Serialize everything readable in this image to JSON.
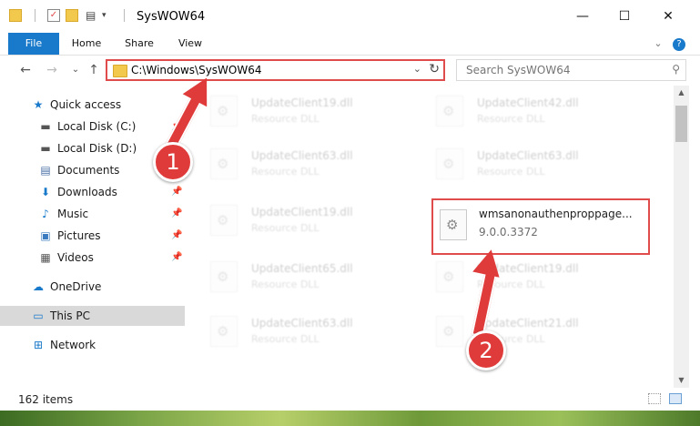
{
  "window": {
    "title": "SysWOW64",
    "controls": {
      "minimize": "—",
      "maximize": "☐",
      "close": "✕"
    }
  },
  "ribbon": {
    "tabs": [
      "File",
      "Home",
      "Share",
      "View"
    ],
    "help": "?",
    "expand": "⌄"
  },
  "navigation": {
    "back": "←",
    "forward": "→",
    "recent": "⌄",
    "up": "↑",
    "address": "C:\\Windows\\SysWOW64",
    "address_dropdown": "⌄",
    "refresh": "↻",
    "search_placeholder": "Search SysWOW64",
    "search_icon": "⚲"
  },
  "sidebar": {
    "items": [
      {
        "label": "Quick access",
        "icon": "star-icon",
        "glyph": "★",
        "color": "#1979ca",
        "pinned": false
      },
      {
        "label": "Local Disk (C:)",
        "icon": "drive-icon",
        "glyph": "▬",
        "color": "#555555",
        "pinned": true
      },
      {
        "label": "Local Disk (D:)",
        "icon": "drive-icon",
        "glyph": "▬",
        "color": "#555555",
        "pinned": true
      },
      {
        "label": "Documents",
        "icon": "document-icon",
        "glyph": "▤",
        "color": "#4a6fa5",
        "pinned": true
      },
      {
        "label": "Downloads",
        "icon": "download-icon",
        "glyph": "⬇",
        "color": "#1979ca",
        "pinned": true
      },
      {
        "label": "Music",
        "icon": "music-icon",
        "glyph": "♪",
        "color": "#1979ca",
        "pinned": true
      },
      {
        "label": "Pictures",
        "icon": "pictures-icon",
        "glyph": "▣",
        "color": "#3a7bbf",
        "pinned": true
      },
      {
        "label": "Videos",
        "icon": "video-icon",
        "glyph": "▦",
        "color": "#555555",
        "pinned": true
      },
      {
        "label": "OneDrive",
        "icon": "cloud-icon",
        "glyph": "☁",
        "color": "#1979ca",
        "pinned": false
      },
      {
        "label": "This PC",
        "icon": "computer-icon",
        "glyph": "▭",
        "color": "#1979ca",
        "pinned": false,
        "selected": true
      },
      {
        "label": "Network",
        "icon": "network-icon",
        "glyph": "⊞",
        "color": "#1979ca",
        "pinned": false
      }
    ],
    "pin_glyph": "📌"
  },
  "files": [
    {
      "name": "UpdateClient19.dll",
      "desc": "Resource DLL",
      "faded": true
    },
    {
      "name": "UpdateClient42.dll",
      "desc": "Resource DLL",
      "faded": true
    },
    {
      "name": "UpdateClient63.dll",
      "desc": "Resource DLL",
      "faded": true
    },
    {
      "name": "UpdateClient63.dll",
      "desc": "Resource DLL",
      "faded": true
    },
    {
      "name": "UpdateClient19.dll",
      "desc": "Resource DLL",
      "faded": true
    },
    {
      "name": "wmsanonauthenproppage...",
      "desc": "9.0.0.3372",
      "faded": false,
      "highlight": true
    },
    {
      "name": "UpdateClient65.dll",
      "desc": "Resource DLL",
      "faded": true
    },
    {
      "name": "UpdateClient19.dll",
      "desc": "Resource DLL",
      "faded": true
    },
    {
      "name": "UpdateClient63.dll",
      "desc": "Resource DLL",
      "faded": true
    },
    {
      "name": "UpdateClient21.dll",
      "desc": "Resource DLL",
      "faded": true
    }
  ],
  "status": {
    "item_count": "162 items"
  },
  "annotations": {
    "step1": "1",
    "step2": "2",
    "color": "#e03b3b"
  }
}
